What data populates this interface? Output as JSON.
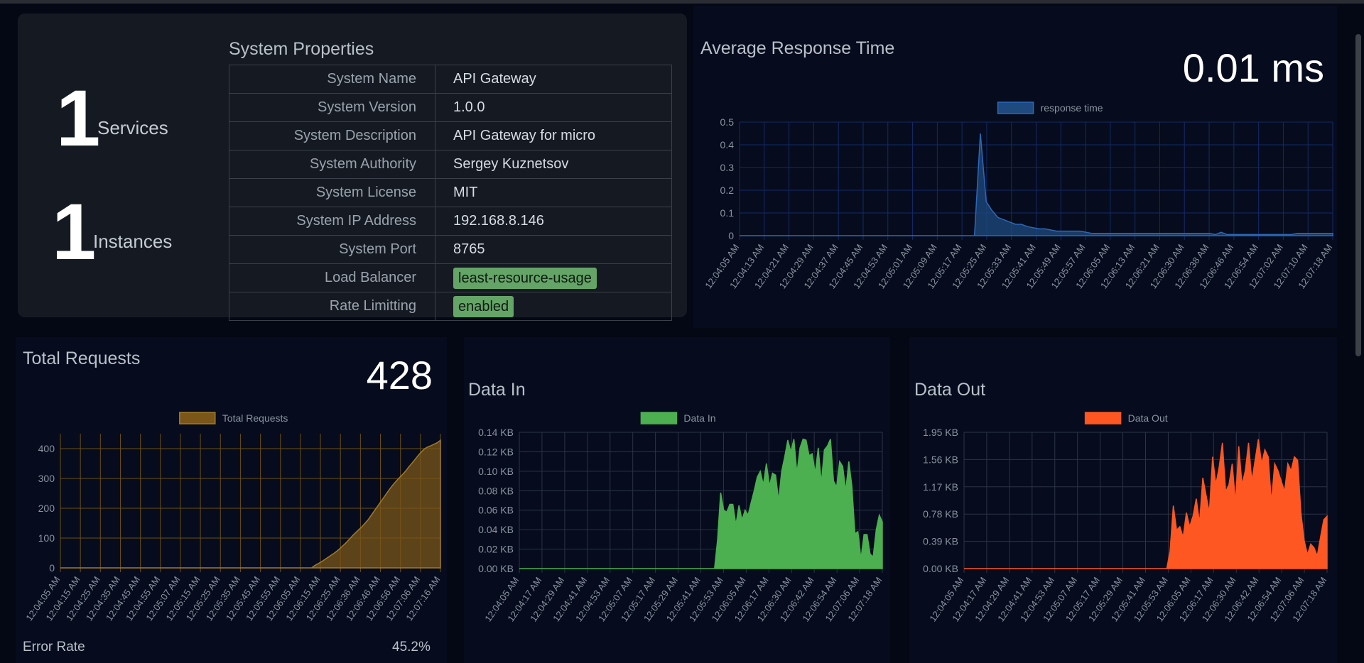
{
  "summary": {
    "services_count": "1",
    "services_label": "Services",
    "instances_count": "1",
    "instances_label": "Instances"
  },
  "properties": {
    "title": "System Properties",
    "rows": [
      {
        "key": "System Name",
        "value": "API Gateway",
        "badge": false
      },
      {
        "key": "System Version",
        "value": "1.0.0",
        "badge": false
      },
      {
        "key": "System Description",
        "value": "API Gateway for micro",
        "badge": false
      },
      {
        "key": "System Authority",
        "value": "Sergey Kuznetsov",
        "badge": false
      },
      {
        "key": "System License",
        "value": "MIT",
        "badge": false
      },
      {
        "key": "System IP Address",
        "value": "192.168.8.146",
        "badge": false
      },
      {
        "key": "System Port",
        "value": "8765",
        "badge": false
      },
      {
        "key": "Load Balancer",
        "value": "least-resource-usage",
        "badge": true
      },
      {
        "key": "Rate Limitting",
        "value": "enabled",
        "badge": true
      }
    ]
  },
  "response_card": {
    "title": "Average Response Time",
    "stat": "0.01 ms"
  },
  "requests_card": {
    "title": "Total Requests",
    "stat": "428",
    "error_label": "Error Rate",
    "error_value": "45.2%"
  },
  "datain_card": {
    "title": "Data In"
  },
  "dataout_card": {
    "title": "Data Out"
  },
  "colors": {
    "response": "#1e4a80",
    "requests": "#7a5618",
    "datain": "#4caf50",
    "dataout": "#ff5722"
  },
  "chart_data": [
    {
      "id": "response",
      "type": "area",
      "legend": [
        "response time"
      ],
      "x_ticks": [
        "12:04:05 AM",
        "12:04:13 AM",
        "12:04:21 AM",
        "12:04:29 AM",
        "12:04:37 AM",
        "12:04:45 AM",
        "12:04:53 AM",
        "12:05:01 AM",
        "12:05:09 AM",
        "12:05:17 AM",
        "12:05:25 AM",
        "12:05:33 AM",
        "12:05:41 AM",
        "12:05:49 AM",
        "12:05:57 AM",
        "12:06:05 AM",
        "12:06:13 AM",
        "12:06:21 AM",
        "12:06:30 AM",
        "12:06:38 AM",
        "12:06:46 AM",
        "12:06:54 AM",
        "12:07:02 AM",
        "12:07:10 AM",
        "12:07:18 AM"
      ],
      "y_ticks": [
        "0",
        "0.1",
        "0.2",
        "0.3",
        "0.4",
        "0.5"
      ],
      "ylim": [
        0,
        0.5
      ],
      "values": [
        0,
        0,
        0,
        0,
        0,
        0,
        0,
        0,
        0,
        0,
        0,
        0,
        0,
        0,
        0,
        0,
        0,
        0,
        0,
        0,
        0,
        0,
        0,
        0,
        0,
        0,
        0,
        0,
        0,
        0,
        0,
        0,
        0,
        0,
        0,
        0,
        0,
        0,
        0,
        0,
        0,
        0.45,
        0.15,
        0.11,
        0.08,
        0.07,
        0.06,
        0.05,
        0.05,
        0.04,
        0.035,
        0.03,
        0.03,
        0.025,
        0.02,
        0.02,
        0.02,
        0.02,
        0.02,
        0.015,
        0.01,
        0.01,
        0.01,
        0.01,
        0.01,
        0.01,
        0.01,
        0.01,
        0.01,
        0.01,
        0.01,
        0.01,
        0.01,
        0.01,
        0.01,
        0.01,
        0.01,
        0.01,
        0.01,
        0.01,
        0.01,
        0.005,
        0.015,
        0.005,
        0.005,
        0.005,
        0.005,
        0.005,
        0.005,
        0.005,
        0.005,
        0.005,
        0.005,
        0.005,
        0.005,
        0.01,
        0.01,
        0.01,
        0.01,
        0.01,
        0.01,
        0.01
      ]
    },
    {
      "id": "requests",
      "type": "area",
      "legend": [
        "Total Requests"
      ],
      "x_ticks": [
        "12:04:05 AM",
        "12:04:15 AM",
        "12:04:25 AM",
        "12:04:35 AM",
        "12:04:45 AM",
        "12:04:55 AM",
        "12:05:07 AM",
        "12:05:15 AM",
        "12:05:25 AM",
        "12:05:35 AM",
        "12:05:45 AM",
        "12:05:55 AM",
        "12:06:05 AM",
        "12:06:15 AM",
        "12:06:25 AM",
        "12:06:36 AM",
        "12:06:46 AM",
        "12:06:56 AM",
        "12:07:06 AM",
        "12:07:16 AM"
      ],
      "y_ticks": [
        "0",
        "100",
        "200",
        "300",
        "400"
      ],
      "ylim": [
        0,
        450
      ],
      "values": [
        0,
        0,
        0,
        0,
        0,
        0,
        0,
        0,
        0,
        0,
        0,
        0,
        0,
        0,
        0,
        0,
        0,
        0,
        0,
        0,
        0,
        0,
        0,
        0,
        0,
        0,
        0,
        0,
        0,
        0,
        0,
        0,
        0,
        0,
        0,
        0,
        0,
        0,
        0,
        0,
        0,
        0,
        0,
        0,
        0,
        0,
        0,
        0,
        0,
        0,
        0,
        0,
        0,
        0,
        0,
        0,
        0,
        0,
        0,
        0,
        0,
        0,
        0,
        0,
        0,
        0,
        0,
        0,
        0,
        0,
        0,
        0,
        0,
        0,
        0,
        0,
        0,
        0,
        0,
        0,
        0,
        8,
        14,
        20,
        27,
        34,
        41,
        48,
        56,
        65,
        75,
        85,
        96,
        108,
        118,
        128,
        138,
        150,
        162,
        177,
        192,
        207,
        222,
        237,
        252,
        267,
        280,
        292,
        303,
        314,
        326,
        340,
        352,
        365,
        378,
        390,
        400,
        406,
        410,
        415,
        420,
        428
      ]
    },
    {
      "id": "datain",
      "type": "area",
      "legend": [
        "Data In"
      ],
      "x_ticks": [
        "12:04:05 AM",
        "12:04:17 AM",
        "12:04:29 AM",
        "12:04:41 AM",
        "12:04:53 AM",
        "12:05:07 AM",
        "12:05:17 AM",
        "12:05:29 AM",
        "12:05:41 AM",
        "12:05:53 AM",
        "12:06:05 AM",
        "12:06:17 AM",
        "12:06:30 AM",
        "12:06:42 AM",
        "12:06:54 AM",
        "12:07:06 AM",
        "12:07:18 AM"
      ],
      "y_ticks": [
        "0.00 KB",
        "0.02 KB",
        "0.04 KB",
        "0.06 KB",
        "0.08 KB",
        "0.10 KB",
        "0.12 KB",
        "0.14 KB"
      ],
      "ylim": [
        0,
        0.14
      ],
      "values": [
        0,
        0,
        0,
        0,
        0,
        0,
        0,
        0,
        0,
        0,
        0,
        0,
        0,
        0,
        0,
        0,
        0,
        0,
        0,
        0,
        0,
        0,
        0,
        0,
        0,
        0,
        0,
        0,
        0,
        0,
        0,
        0,
        0,
        0,
        0,
        0,
        0,
        0,
        0,
        0,
        0,
        0,
        0,
        0,
        0,
        0,
        0,
        0,
        0,
        0,
        0,
        0,
        0,
        0,
        0,
        0,
        0,
        0,
        0,
        0,
        0,
        0,
        0,
        0,
        0,
        0.03,
        0.078,
        0.06,
        0.058,
        0.066,
        0.066,
        0.045,
        0.065,
        0.05,
        0.06,
        0.055,
        0.068,
        0.08,
        0.094,
        0.1,
        0.086,
        0.108,
        0.085,
        0.098,
        0.096,
        0.07,
        0.1,
        0.115,
        0.132,
        0.12,
        0.133,
        0.098,
        0.124,
        0.133,
        0.132,
        0.116,
        0.118,
        0.098,
        0.124,
        0.088,
        0.122,
        0.126,
        0.133,
        0.09,
        0.084,
        0.11,
        0.105,
        0.08,
        0.11,
        0.085,
        0.036,
        0.038,
        0.01,
        0.035,
        0.035,
        0.015,
        0.012,
        0.04,
        0.055,
        0.048
      ]
    },
    {
      "id": "dataout",
      "type": "area",
      "legend": [
        "Data Out"
      ],
      "x_ticks": [
        "12:04:05 AM",
        "12:04:17 AM",
        "12:04:29 AM",
        "12:04:41 AM",
        "12:04:53 AM",
        "12:05:07 AM",
        "12:05:17 AM",
        "12:05:29 AM",
        "12:05:41 AM",
        "12:05:53 AM",
        "12:06:05 AM",
        "12:06:17 AM",
        "12:06:30 AM",
        "12:06:42 AM",
        "12:06:54 AM",
        "12:07:06 AM",
        "12:07:18 AM"
      ],
      "y_ticks": [
        "0.00 KB",
        "0.39 KB",
        "0.78 KB",
        "1.17 KB",
        "1.56 KB",
        "1.95 KB"
      ],
      "ylim": [
        0,
        1.95
      ],
      "values": [
        0,
        0,
        0,
        0,
        0,
        0,
        0,
        0,
        0,
        0,
        0,
        0,
        0,
        0,
        0,
        0,
        0,
        0,
        0,
        0,
        0,
        0,
        0,
        0,
        0,
        0,
        0,
        0,
        0,
        0,
        0,
        0,
        0,
        0,
        0,
        0,
        0,
        0,
        0,
        0,
        0,
        0,
        0,
        0,
        0,
        0,
        0,
        0,
        0,
        0,
        0,
        0,
        0,
        0,
        0,
        0,
        0,
        0,
        0,
        0,
        0,
        0,
        0,
        0.25,
        0.9,
        0.55,
        0.6,
        0.45,
        0.8,
        0.6,
        0.75,
        1.0,
        0.65,
        1.3,
        1.05,
        0.8,
        1.6,
        1.2,
        1.45,
        1.8,
        1.1,
        1.2,
        1.5,
        0.95,
        1.75,
        1.2,
        1.4,
        1.8,
        1.25,
        1.55,
        1.85,
        1.5,
        1.7,
        1.6,
        0.95,
        1.5,
        1.4,
        1.25,
        1.1,
        1.5,
        1.4,
        1.6,
        1.55,
        0.8,
        0.4,
        0.2,
        0.35,
        0.3,
        0.18,
        0.45,
        0.7,
        0.75
      ]
    }
  ]
}
